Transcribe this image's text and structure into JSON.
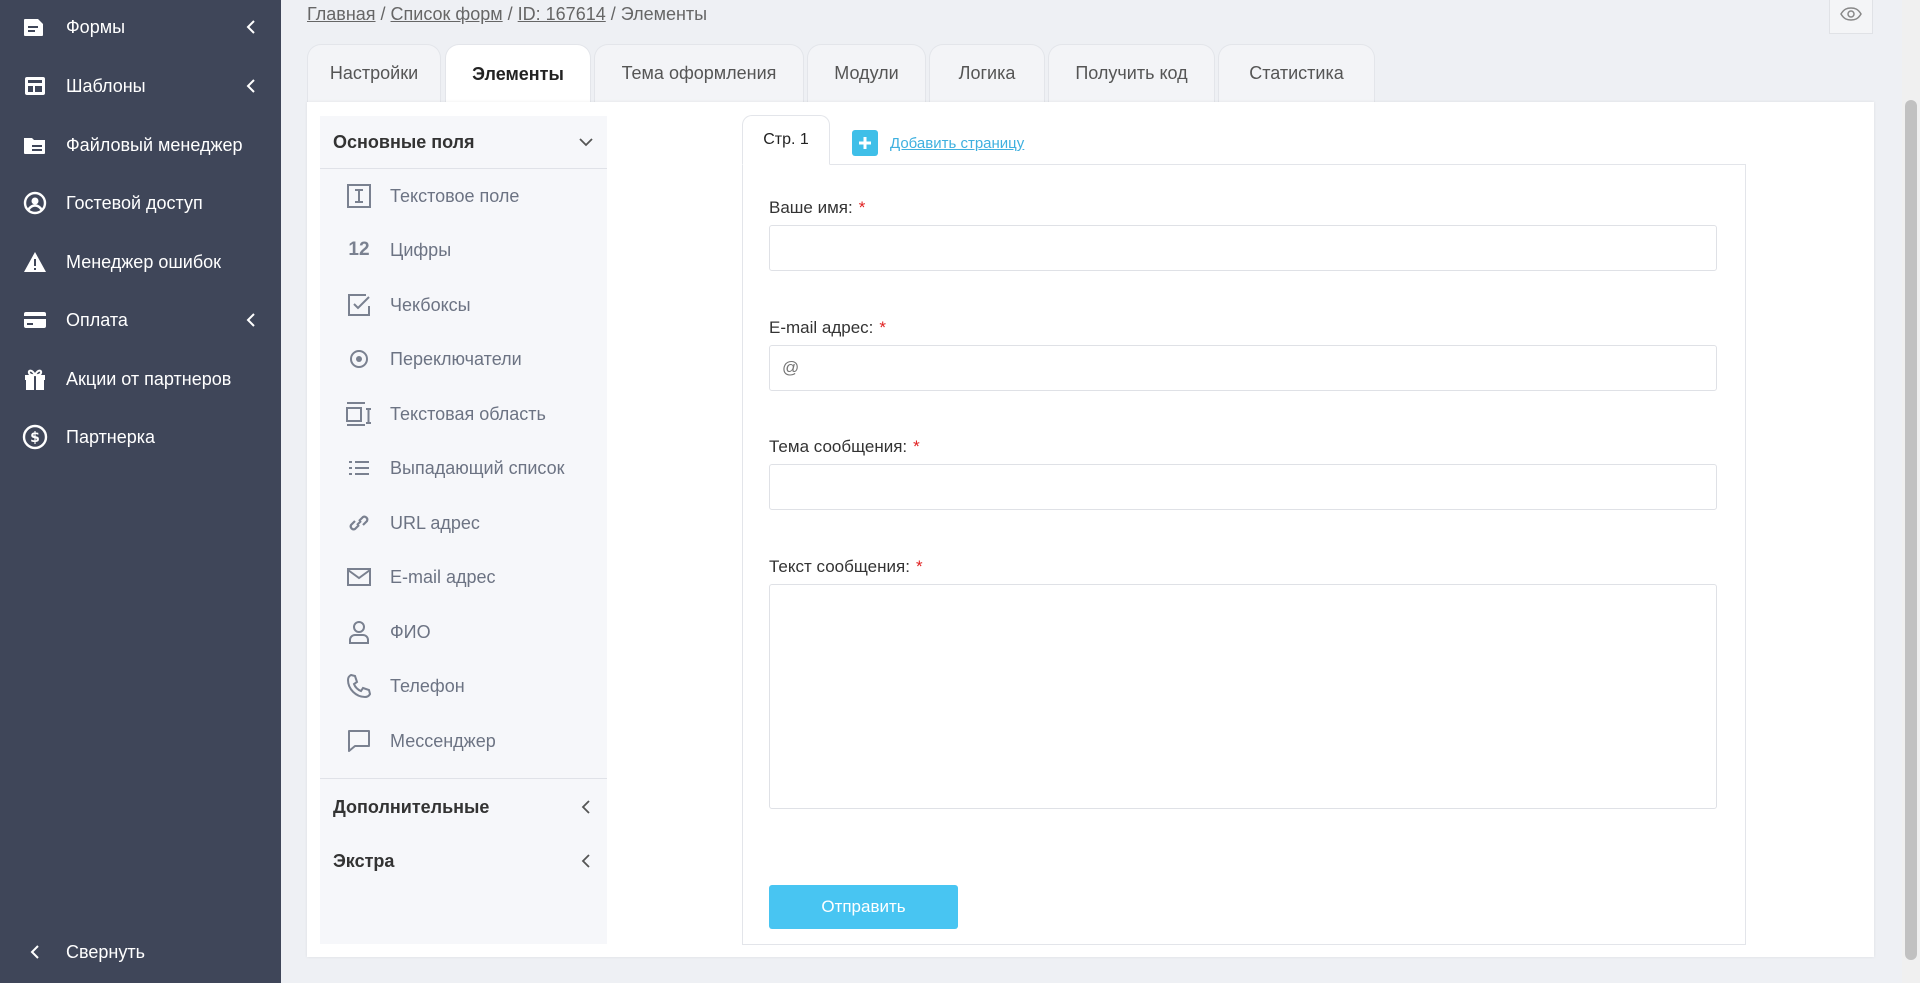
{
  "sidebar": {
    "items": [
      {
        "label": "Формы",
        "icon": "forms-icon",
        "has_chevron": true
      },
      {
        "label": "Шаблоны",
        "icon": "templates-icon",
        "has_chevron": true
      },
      {
        "label": "Файловый менеджер",
        "icon": "file-manager-icon",
        "has_chevron": false
      },
      {
        "label": "Гостевой доступ",
        "icon": "guest-user-icon",
        "has_chevron": false
      },
      {
        "label": "Менеджер ошибок",
        "icon": "warning-icon",
        "has_chevron": false
      },
      {
        "label": "Оплата",
        "icon": "credit-card-icon",
        "has_chevron": true
      },
      {
        "label": "Акции от партнеров",
        "icon": "gift-icon",
        "has_chevron": false
      },
      {
        "label": "Партнерка",
        "icon": "dollar-circle-icon",
        "has_chevron": false
      }
    ],
    "collapse_label": "Свернуть"
  },
  "breadcrumb": {
    "home": "Главная",
    "sep1": " / ",
    "forms_list": "Список форм",
    "sep2": " / ",
    "form_id": "ID: 167614",
    "sep3": " / ",
    "current": "Элементы"
  },
  "tabs": [
    {
      "label": "Настройки",
      "active": false
    },
    {
      "label": "Элементы",
      "active": true
    },
    {
      "label": "Тема оформления",
      "active": false
    },
    {
      "label": "Модули",
      "active": false
    },
    {
      "label": "Логика",
      "active": false
    },
    {
      "label": "Получить код",
      "active": false
    },
    {
      "label": "Статистика",
      "active": false
    }
  ],
  "palette": {
    "basic_header": "Основные поля",
    "items": [
      {
        "label": "Текстовое поле",
        "icon": "text-field-icon"
      },
      {
        "label": "Цифры",
        "icon": "numbers-icon",
        "glyph": "12"
      },
      {
        "label": "Чекбоксы",
        "icon": "checkbox-icon"
      },
      {
        "label": "Переключатели",
        "icon": "radio-icon"
      },
      {
        "label": "Текстовая область",
        "icon": "textarea-icon"
      },
      {
        "label": "Выпадающий список",
        "icon": "list-icon"
      },
      {
        "label": "URL адрес",
        "icon": "link-icon"
      },
      {
        "label": "E-mail адрес",
        "icon": "envelope-icon"
      },
      {
        "label": "ФИО",
        "icon": "user-icon"
      },
      {
        "label": "Телефон",
        "icon": "phone-icon"
      },
      {
        "label": "Мессенджер",
        "icon": "chat-icon"
      }
    ],
    "additional_header": "Дополнительные",
    "extra_header": "Экстра"
  },
  "form": {
    "page_tab": "Стр. 1",
    "add_page": "Добавить страницу",
    "fields": {
      "name_label": "Ваше имя:",
      "email_label": "E-mail адрес:",
      "email_placeholder": "@",
      "subject_label": "Тема сообщения:",
      "message_label": "Текст сообщения:",
      "required_mark": "*"
    },
    "submit_label": "Отправить"
  },
  "colors": {
    "sidebar_bg": "#3f4659",
    "accent": "#48c5f2",
    "required": "#e02020"
  }
}
